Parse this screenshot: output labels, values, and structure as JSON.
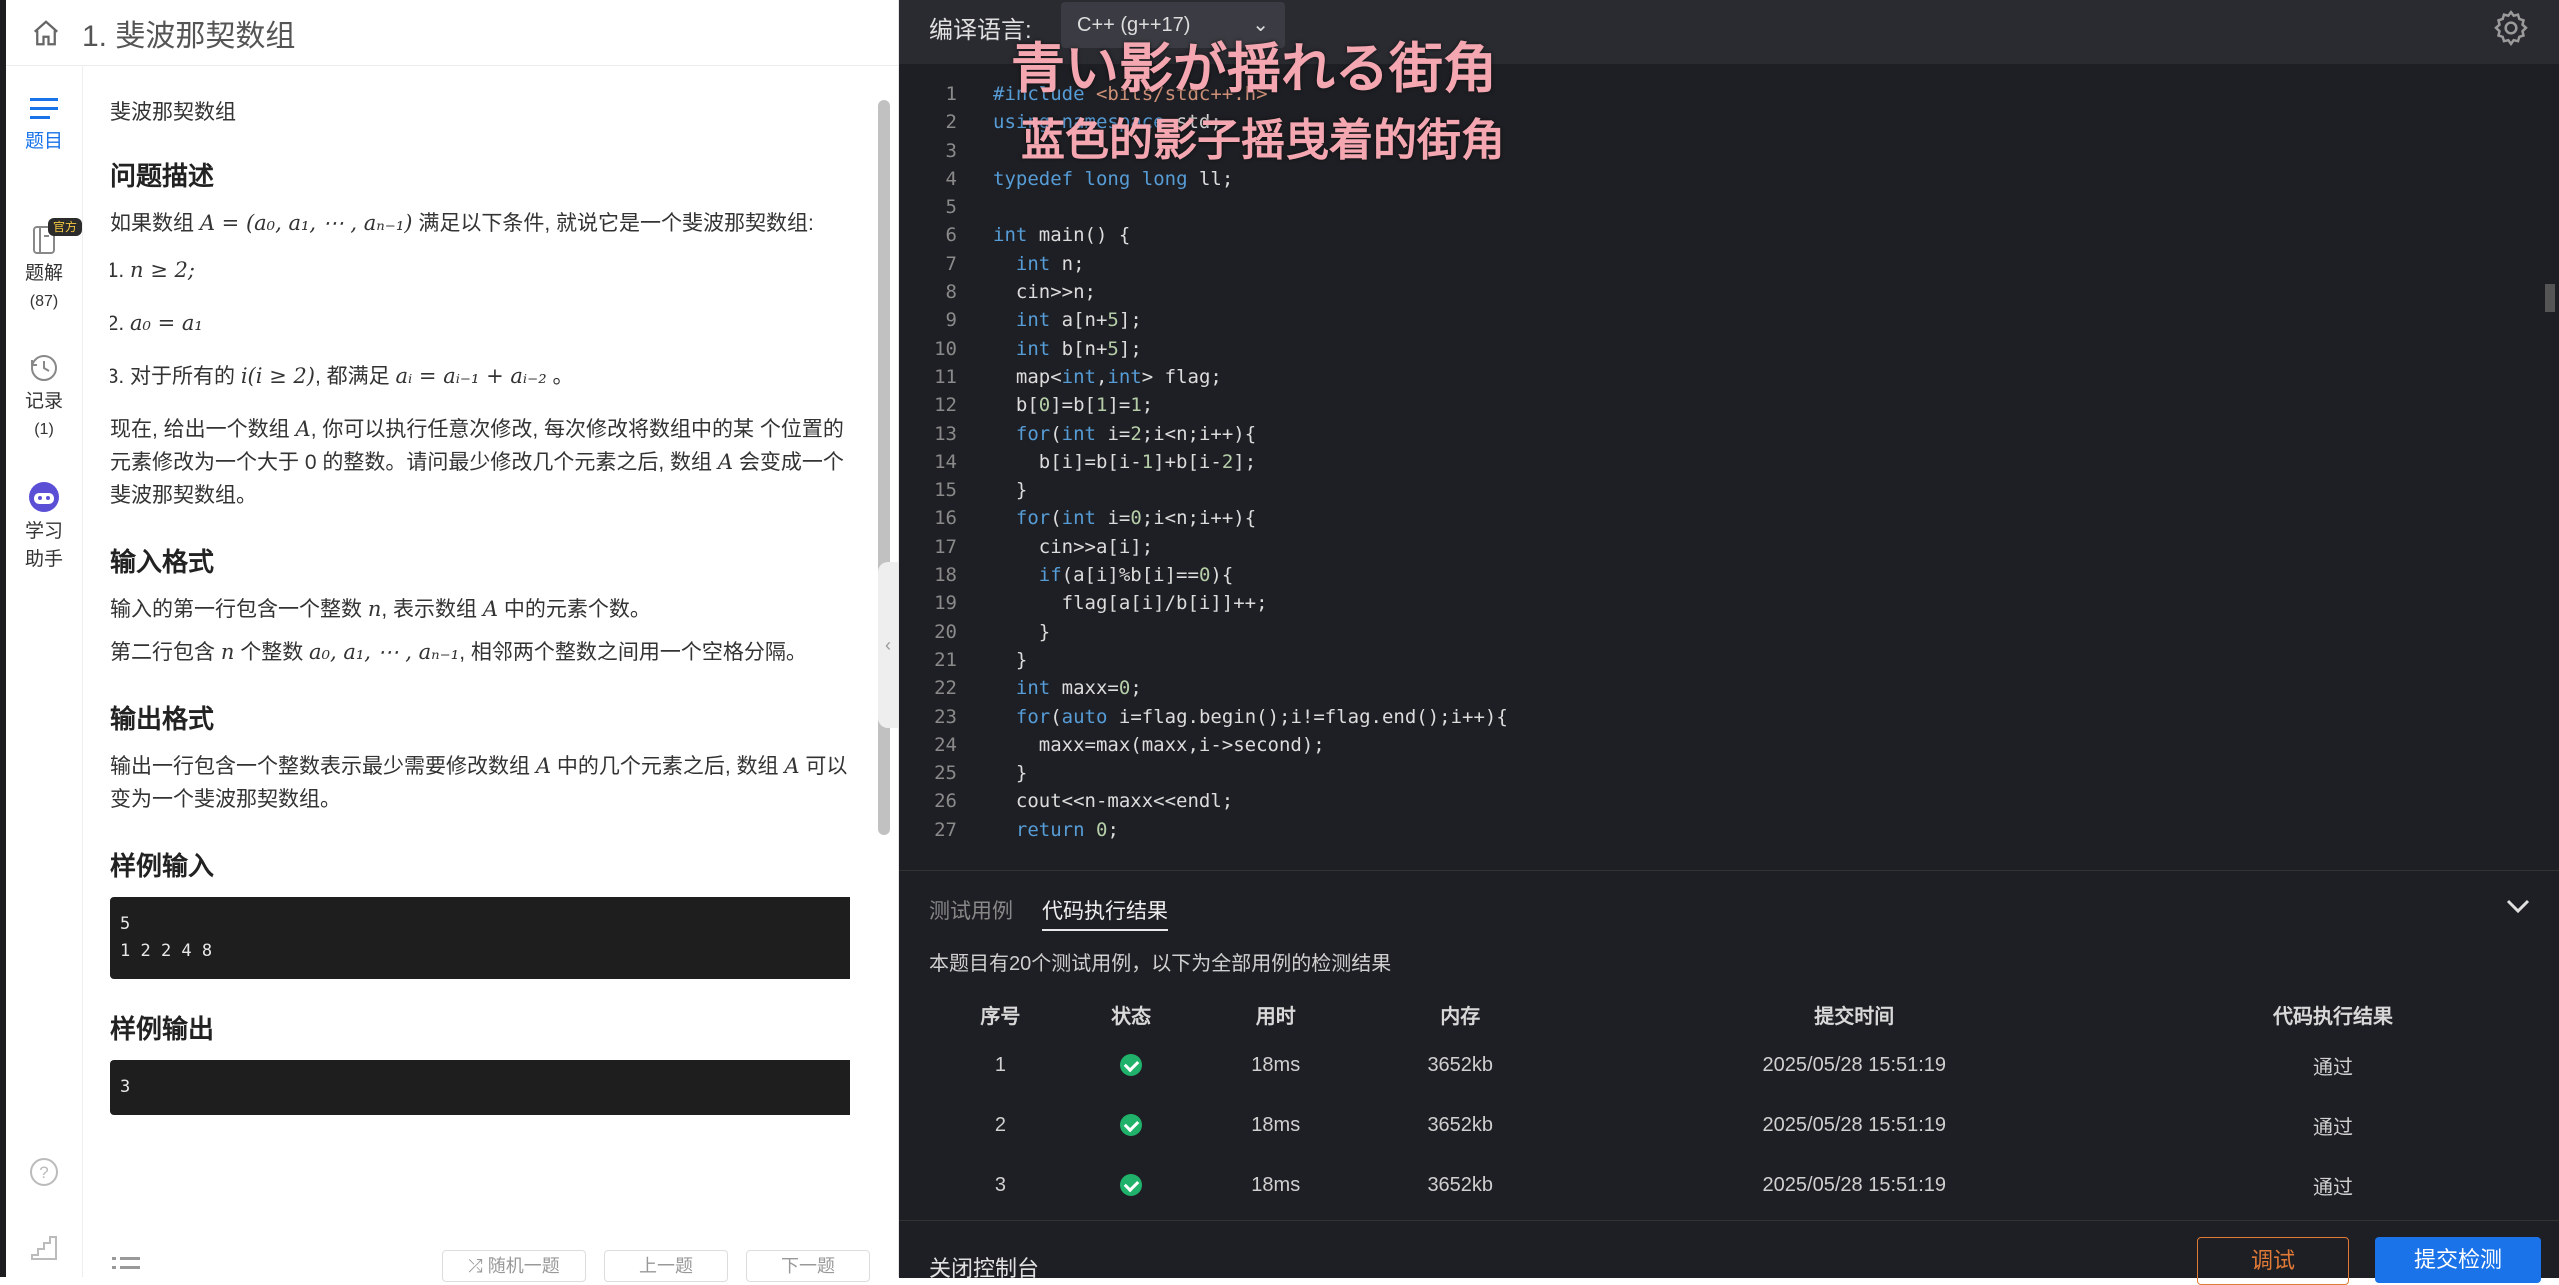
{
  "header": {
    "title": "1. 斐波那契数组"
  },
  "sidenav": {
    "items": [
      {
        "label": "题目"
      },
      {
        "label": "题解",
        "count": "(87)",
        "badge": "官方"
      },
      {
        "label": "记录",
        "count": "(1)"
      },
      {
        "label": "学习\n助手"
      }
    ]
  },
  "problem": {
    "crumb": "斐波那契数组",
    "desc_heading": "问题描述",
    "desc_intro_a": "如果数组 ",
    "desc_intro_math": "A = (a₀, a₁, ⋯ , aₙ₋₁)",
    "desc_intro_b": " 满足以下条件, 就说它是一个斐波那契数组:",
    "cond1": "n ≥ 2;",
    "cond2": "a₀ = a₁",
    "cond3_a": "对于所有的 ",
    "cond3_math1": "i(i ≥ 2)",
    "cond3_b": ", 都满足 ",
    "cond3_math2": "aᵢ = aᵢ₋₁ + aᵢ₋₂",
    "cond3_c": " 。",
    "para2_a": "现在, 给出一个数组 ",
    "para2_m1": "A",
    "para2_b": ", 你可以执行任意次修改, 每次修改将数组中的某 个位置的元素修改为一个大于 0 的整数。请问最少修改几个元素之后, 数组 ",
    "para2_m2": "A",
    "para2_c": " 会变成一个斐波那契数组。",
    "input_heading": "输入格式",
    "input_p1_a": "输入的第一行包含一个整数 ",
    "input_p1_m": "n",
    "input_p1_b": ", 表示数组 ",
    "input_p1_m2": "A",
    "input_p1_c": " 中的元素个数。",
    "input_p2_a": "第二行包含 ",
    "input_p2_m": "n",
    "input_p2_b": " 个整数 ",
    "input_p2_m2": "a₀, a₁, ⋯ , aₙ₋₁",
    "input_p2_c": ", 相邻两个整数之间用一个空格分隔。",
    "output_heading": "输出格式",
    "output_p_a": "输出一行包含一个整数表示最少需要修改数组 ",
    "output_p_m": "A",
    "output_p_b": " 中的几个元素之后, 数组 ",
    "output_p_m2": "A",
    "output_p_c": " 可以变为一个斐波那契数组。",
    "sample_in_heading": "样例输入",
    "sample_in": "5\n1 2 2 4 8",
    "sample_out_heading": "样例输出",
    "sample_out": "3"
  },
  "left_bottom": {
    "random": "随机一题",
    "prev": "上一题",
    "next": "下一题"
  },
  "editor": {
    "lang_label": "编译语言:",
    "lang_value": "C++ (g++17)",
    "overlay_jp": "青い影が揺れる街角",
    "overlay_cn": "蓝色的影子摇曳着的街角"
  },
  "console": {
    "tab_tests": "测试用例",
    "tab_result": "代码执行结果",
    "summary": "本题目有20个测试用例，以下为全部用例的检测结果",
    "headers": [
      "序号",
      "状态",
      "用时",
      "内存",
      "提交时间",
      "代码执行结果"
    ],
    "rows": [
      {
        "id": "1",
        "time": "18ms",
        "mem": "3652kb",
        "submitted": "2025/05/28 15:51:19",
        "result": "通过"
      },
      {
        "id": "2",
        "time": "18ms",
        "mem": "3652kb",
        "submitted": "2025/05/28 15:51:19",
        "result": "通过"
      },
      {
        "id": "3",
        "time": "18ms",
        "mem": "3652kb",
        "submitted": "2025/05/28 15:51:19",
        "result": "通过"
      }
    ],
    "close_label": "关闭控制台",
    "debug_label": "调试",
    "submit_label": "提交检测"
  },
  "colors": {
    "accent": "#1a73e8",
    "debug": "#e07a36",
    "pass": "#20b26b",
    "editor_bg": "#1e1f24"
  }
}
